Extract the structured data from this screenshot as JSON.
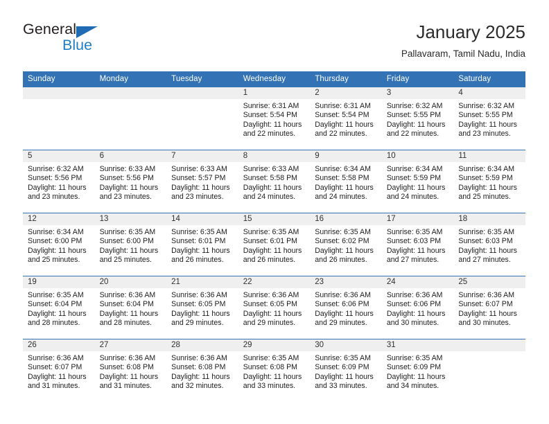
{
  "brand": {
    "name_top": "General",
    "name_bottom": "Blue",
    "triangle_color": "#1f6cb4",
    "blue_color": "#1f7ec4"
  },
  "header": {
    "title": "January 2025",
    "subtitle": "Pallavaram, Tamil Nadu, India",
    "accent_color": "#3272b5",
    "band_color": "#efefef"
  },
  "calendar": {
    "weekday_headers": [
      "Sunday",
      "Monday",
      "Tuesday",
      "Wednesday",
      "Thursday",
      "Friday",
      "Saturday"
    ],
    "weeks": [
      [
        {
          "day": "",
          "sunrise": "",
          "sunset": "",
          "daylight_line1": "",
          "daylight_line2": ""
        },
        {
          "day": "",
          "sunrise": "",
          "sunset": "",
          "daylight_line1": "",
          "daylight_line2": ""
        },
        {
          "day": "",
          "sunrise": "",
          "sunset": "",
          "daylight_line1": "",
          "daylight_line2": ""
        },
        {
          "day": "1",
          "sunrise": "Sunrise: 6:31 AM",
          "sunset": "Sunset: 5:54 PM",
          "daylight_line1": "Daylight: 11 hours",
          "daylight_line2": "and 22 minutes."
        },
        {
          "day": "2",
          "sunrise": "Sunrise: 6:31 AM",
          "sunset": "Sunset: 5:54 PM",
          "daylight_line1": "Daylight: 11 hours",
          "daylight_line2": "and 22 minutes."
        },
        {
          "day": "3",
          "sunrise": "Sunrise: 6:32 AM",
          "sunset": "Sunset: 5:55 PM",
          "daylight_line1": "Daylight: 11 hours",
          "daylight_line2": "and 22 minutes."
        },
        {
          "day": "4",
          "sunrise": "Sunrise: 6:32 AM",
          "sunset": "Sunset: 5:55 PM",
          "daylight_line1": "Daylight: 11 hours",
          "daylight_line2": "and 23 minutes."
        }
      ],
      [
        {
          "day": "5",
          "sunrise": "Sunrise: 6:32 AM",
          "sunset": "Sunset: 5:56 PM",
          "daylight_line1": "Daylight: 11 hours",
          "daylight_line2": "and 23 minutes."
        },
        {
          "day": "6",
          "sunrise": "Sunrise: 6:33 AM",
          "sunset": "Sunset: 5:56 PM",
          "daylight_line1": "Daylight: 11 hours",
          "daylight_line2": "and 23 minutes."
        },
        {
          "day": "7",
          "sunrise": "Sunrise: 6:33 AM",
          "sunset": "Sunset: 5:57 PM",
          "daylight_line1": "Daylight: 11 hours",
          "daylight_line2": "and 23 minutes."
        },
        {
          "day": "8",
          "sunrise": "Sunrise: 6:33 AM",
          "sunset": "Sunset: 5:58 PM",
          "daylight_line1": "Daylight: 11 hours",
          "daylight_line2": "and 24 minutes."
        },
        {
          "day": "9",
          "sunrise": "Sunrise: 6:34 AM",
          "sunset": "Sunset: 5:58 PM",
          "daylight_line1": "Daylight: 11 hours",
          "daylight_line2": "and 24 minutes."
        },
        {
          "day": "10",
          "sunrise": "Sunrise: 6:34 AM",
          "sunset": "Sunset: 5:59 PM",
          "daylight_line1": "Daylight: 11 hours",
          "daylight_line2": "and 24 minutes."
        },
        {
          "day": "11",
          "sunrise": "Sunrise: 6:34 AM",
          "sunset": "Sunset: 5:59 PM",
          "daylight_line1": "Daylight: 11 hours",
          "daylight_line2": "and 25 minutes."
        }
      ],
      [
        {
          "day": "12",
          "sunrise": "Sunrise: 6:34 AM",
          "sunset": "Sunset: 6:00 PM",
          "daylight_line1": "Daylight: 11 hours",
          "daylight_line2": "and 25 minutes."
        },
        {
          "day": "13",
          "sunrise": "Sunrise: 6:35 AM",
          "sunset": "Sunset: 6:00 PM",
          "daylight_line1": "Daylight: 11 hours",
          "daylight_line2": "and 25 minutes."
        },
        {
          "day": "14",
          "sunrise": "Sunrise: 6:35 AM",
          "sunset": "Sunset: 6:01 PM",
          "daylight_line1": "Daylight: 11 hours",
          "daylight_line2": "and 26 minutes."
        },
        {
          "day": "15",
          "sunrise": "Sunrise: 6:35 AM",
          "sunset": "Sunset: 6:01 PM",
          "daylight_line1": "Daylight: 11 hours",
          "daylight_line2": "and 26 minutes."
        },
        {
          "day": "16",
          "sunrise": "Sunrise: 6:35 AM",
          "sunset": "Sunset: 6:02 PM",
          "daylight_line1": "Daylight: 11 hours",
          "daylight_line2": "and 26 minutes."
        },
        {
          "day": "17",
          "sunrise": "Sunrise: 6:35 AM",
          "sunset": "Sunset: 6:03 PM",
          "daylight_line1": "Daylight: 11 hours",
          "daylight_line2": "and 27 minutes."
        },
        {
          "day": "18",
          "sunrise": "Sunrise: 6:35 AM",
          "sunset": "Sunset: 6:03 PM",
          "daylight_line1": "Daylight: 11 hours",
          "daylight_line2": "and 27 minutes."
        }
      ],
      [
        {
          "day": "19",
          "sunrise": "Sunrise: 6:35 AM",
          "sunset": "Sunset: 6:04 PM",
          "daylight_line1": "Daylight: 11 hours",
          "daylight_line2": "and 28 minutes."
        },
        {
          "day": "20",
          "sunrise": "Sunrise: 6:36 AM",
          "sunset": "Sunset: 6:04 PM",
          "daylight_line1": "Daylight: 11 hours",
          "daylight_line2": "and 28 minutes."
        },
        {
          "day": "21",
          "sunrise": "Sunrise: 6:36 AM",
          "sunset": "Sunset: 6:05 PM",
          "daylight_line1": "Daylight: 11 hours",
          "daylight_line2": "and 29 minutes."
        },
        {
          "day": "22",
          "sunrise": "Sunrise: 6:36 AM",
          "sunset": "Sunset: 6:05 PM",
          "daylight_line1": "Daylight: 11 hours",
          "daylight_line2": "and 29 minutes."
        },
        {
          "day": "23",
          "sunrise": "Sunrise: 6:36 AM",
          "sunset": "Sunset: 6:06 PM",
          "daylight_line1": "Daylight: 11 hours",
          "daylight_line2": "and 29 minutes."
        },
        {
          "day": "24",
          "sunrise": "Sunrise: 6:36 AM",
          "sunset": "Sunset: 6:06 PM",
          "daylight_line1": "Daylight: 11 hours",
          "daylight_line2": "and 30 minutes."
        },
        {
          "day": "25",
          "sunrise": "Sunrise: 6:36 AM",
          "sunset": "Sunset: 6:07 PM",
          "daylight_line1": "Daylight: 11 hours",
          "daylight_line2": "and 30 minutes."
        }
      ],
      [
        {
          "day": "26",
          "sunrise": "Sunrise: 6:36 AM",
          "sunset": "Sunset: 6:07 PM",
          "daylight_line1": "Daylight: 11 hours",
          "daylight_line2": "and 31 minutes."
        },
        {
          "day": "27",
          "sunrise": "Sunrise: 6:36 AM",
          "sunset": "Sunset: 6:08 PM",
          "daylight_line1": "Daylight: 11 hours",
          "daylight_line2": "and 31 minutes."
        },
        {
          "day": "28",
          "sunrise": "Sunrise: 6:36 AM",
          "sunset": "Sunset: 6:08 PM",
          "daylight_line1": "Daylight: 11 hours",
          "daylight_line2": "and 32 minutes."
        },
        {
          "day": "29",
          "sunrise": "Sunrise: 6:35 AM",
          "sunset": "Sunset: 6:08 PM",
          "daylight_line1": "Daylight: 11 hours",
          "daylight_line2": "and 33 minutes."
        },
        {
          "day": "30",
          "sunrise": "Sunrise: 6:35 AM",
          "sunset": "Sunset: 6:09 PM",
          "daylight_line1": "Daylight: 11 hours",
          "daylight_line2": "and 33 minutes."
        },
        {
          "day": "31",
          "sunrise": "Sunrise: 6:35 AM",
          "sunset": "Sunset: 6:09 PM",
          "daylight_line1": "Daylight: 11 hours",
          "daylight_line2": "and 34 minutes."
        },
        {
          "day": "",
          "sunrise": "",
          "sunset": "",
          "daylight_line1": "",
          "daylight_line2": ""
        }
      ]
    ]
  }
}
